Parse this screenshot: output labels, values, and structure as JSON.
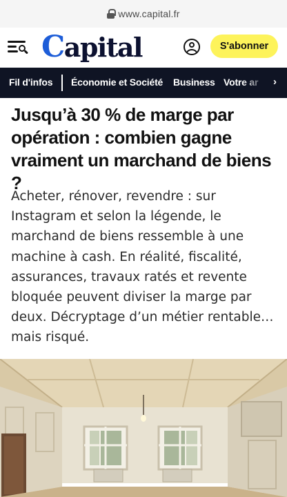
{
  "browser": {
    "url": "www.capital.fr"
  },
  "header": {
    "logo_text": "Capital",
    "subscribe_label": "S'abonner"
  },
  "nav": {
    "items": [
      "Fil d'infos",
      "Économie et Société",
      "Business",
      "Votre ar"
    ]
  },
  "article": {
    "headline": "Jusqu’à 30 % de marge par opération : combien gagne vraiment un marchand de biens ?",
    "lede": "Acheter, rénover, revendre : sur Instagram et selon la légende, le marchand de biens ressemble à une machine à cash. En réalité, fiscalité, assurances, travaux ratés et revente bloquée peuvent diviser la marge par deux. Décryptage d’un métier rentable… mais risqué."
  },
  "colors": {
    "brand_blue": "#1d5dd8",
    "subscribe_yellow": "#fdf35b",
    "nav_background": "#0f1424"
  }
}
